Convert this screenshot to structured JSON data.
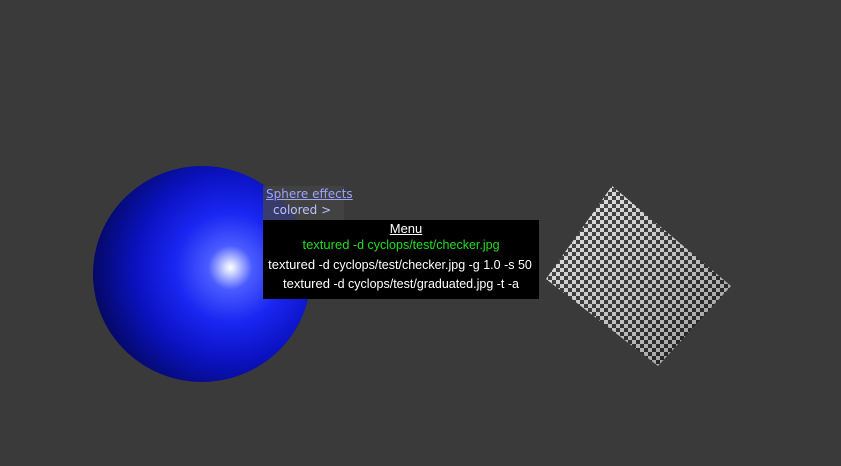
{
  "sphere_menu": {
    "title": "Sphere effects",
    "item": "colored  >",
    "hidden_item": "textured"
  },
  "menu": {
    "title": "Menu",
    "items": [
      {
        "keyword": "textured",
        "args": "-d cyclops/test/checker.jpg",
        "active": true
      },
      {
        "keyword": "textured",
        "args": "-d cyclops/test/checker.jpg -g 1.0 -s 50",
        "active": false
      },
      {
        "keyword": "textured",
        "args": "-d cyclops/test/graduated.jpg -t -a",
        "active": false
      }
    ]
  },
  "colors": {
    "background": "#3a3a3a",
    "sphere": "#1a26f2",
    "active_item": "#22dd22",
    "menu_bg": "#000000"
  },
  "objects": {
    "sphere": "blue-shaded-sphere",
    "plane": "checkered-plane"
  }
}
